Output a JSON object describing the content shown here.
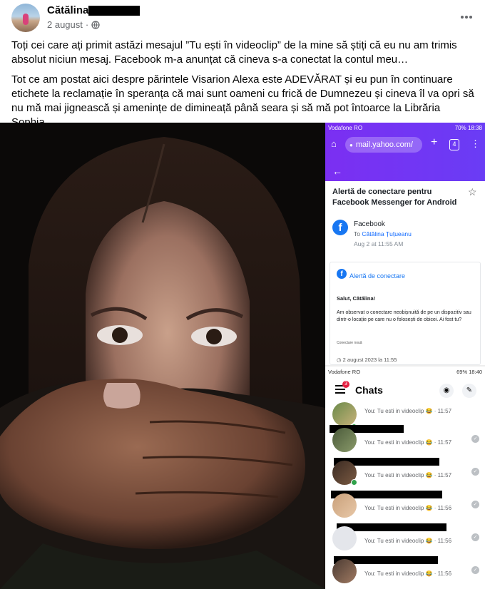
{
  "post": {
    "author_visible": "Cătălina",
    "date": "2 august",
    "date_sep": "·",
    "paragraph1": "Toți cei care ați primit astăzi mesajul ”Tu ești în videoclip” de la mine să știți că eu nu am trimis absolut niciun mesaj. Facebook m-a anunțat că cineva s-a conectat la contul meu…",
    "paragraph2": "Tot ce am postat aici despre părintele Visarion Alexa este ADEVĂRAT și eu pun în continuare etichete la reclamație în speranța că mai sunt oameni cu frică de Dumnezeu și cineva îl va opri să nu mă mai jignească și amenințe de dimineață până seara și să mă pot întoarce la Librăria Sophia."
  },
  "yahoo": {
    "carrier": "Vodafone RO",
    "status_right": "70% 18:38",
    "url": "mail.yahoo.com/",
    "tab_count": "4",
    "subject": "Alertă de conectare pentru Facebook Messenger for Android",
    "sender": "Facebook",
    "to_label": "To",
    "to_name": "Cătălina Țuțueanu",
    "date": "Aug 2 at 11:55 AM",
    "alert_title": "Alertă de conectare",
    "greeting": "Salut, Cătălina!",
    "body": "Am observat o conectare neobișnuită de pe un dispozitiv sau dintr-o locație pe care nu o folosești de obicei. Ai fost tu?",
    "small_label": "Conectare nouă",
    "alert_date": "2 august 2023 la 11:55"
  },
  "messenger": {
    "carrier": "Vodafone RO",
    "status_right": "69% 18:40",
    "title": "Chats",
    "badge": "3",
    "rows": [
      {
        "msg": "You: Tu esti in videoclip 😂 · 11:57"
      },
      {
        "msg": "You: Tu esti in videoclip 😂 · 11:57"
      },
      {
        "msg": "You: Tu esti in videoclip 😂 · 11:57"
      },
      {
        "msg": "You: Tu esti in videoclip 😂 · 11:56"
      },
      {
        "msg": "You: Tu esti in videoclip 😂 · 11:56"
      },
      {
        "msg": "You: Tu esti in videoclip 😂 · 11:56"
      }
    ]
  },
  "colors": {
    "fb_blue": "#1877f2",
    "yahoo_purple": "#6a3cf5",
    "secondary_text": "#65676b"
  }
}
